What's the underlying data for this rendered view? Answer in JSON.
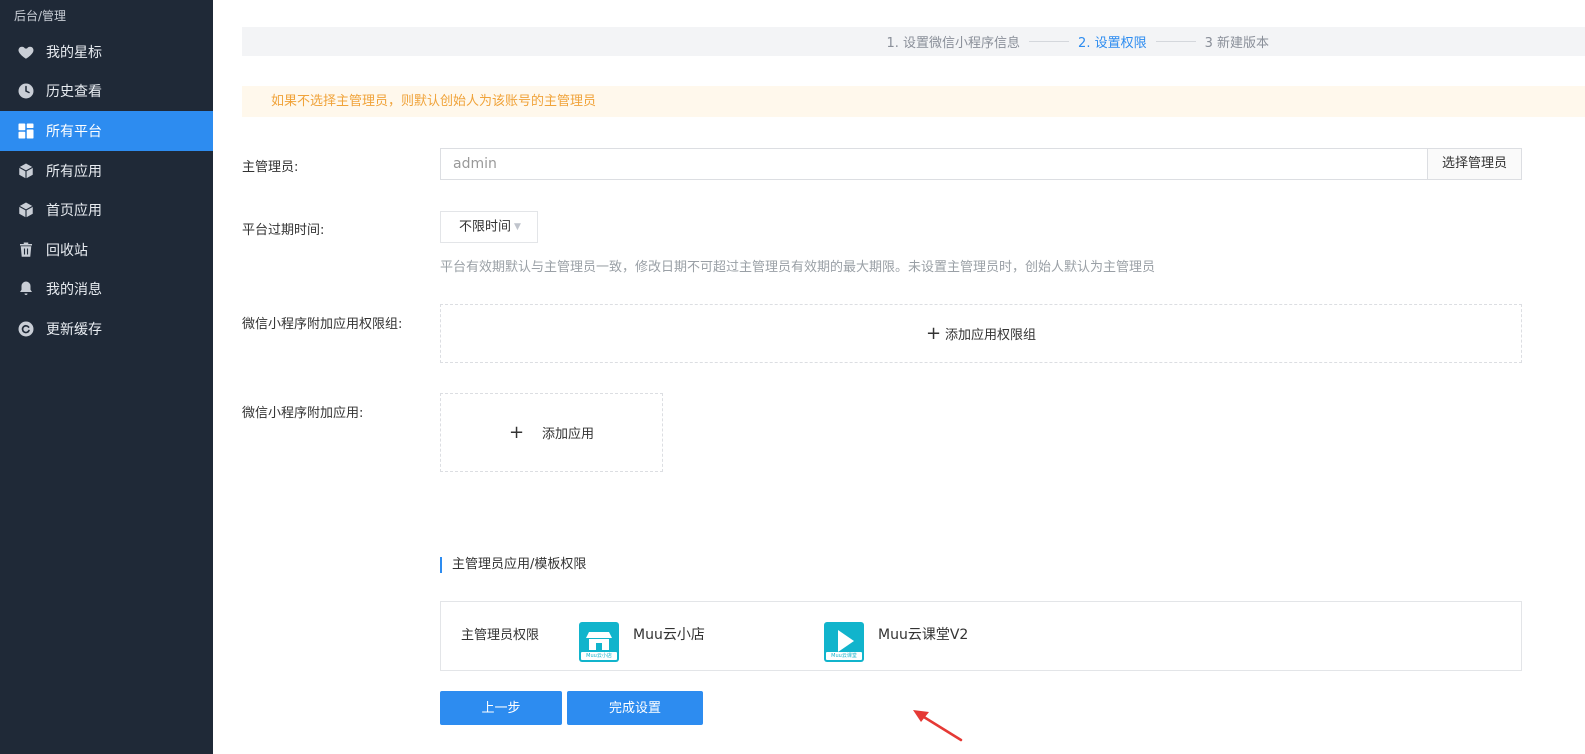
{
  "sidebar": {
    "breadcrumb": "后台/管理",
    "items": [
      {
        "label": "我的星标",
        "icon": "heart-icon"
      },
      {
        "label": "历史查看",
        "icon": "clock-icon"
      },
      {
        "label": "所有平台",
        "icon": "grid-icon"
      },
      {
        "label": "所有应用",
        "icon": "cube-icon"
      },
      {
        "label": "首页应用",
        "icon": "cube-icon"
      },
      {
        "label": "回收站",
        "icon": "trash-icon"
      },
      {
        "label": "我的消息",
        "icon": "bell-icon"
      },
      {
        "label": "更新缓存",
        "icon": "refresh-icon"
      }
    ],
    "active_index": 2
  },
  "steps": [
    {
      "label": "1. 设置微信小程序信息",
      "active": false
    },
    {
      "label": "2. 设置权限",
      "active": true
    },
    {
      "label": "3 新建版本",
      "active": false
    }
  ],
  "notice": "如果不选择主管理员，则默认创始人为该账号的主管理员",
  "form": {
    "admin_label": "主管理员:",
    "admin_placeholder": "admin",
    "select_admin_button": "选择管理员",
    "expiry_label": "平台过期时间:",
    "expiry_value": "不限时间",
    "expiry_hint": "平台有效期默认与主管理员一致，修改日期不可超过主管理员有效期的最大期限。未设置主管理员时，创始人默认为主管理员",
    "perm_group_label": "微信小程序附加应用权限组:",
    "add_perm_group": "添加应用权限组",
    "extra_app_label": "微信小程序附加应用:",
    "add_app": "添加应用"
  },
  "admin_perms": {
    "section_title": "主管理员应用/模板权限",
    "row_label": "主管理员权限",
    "apps": [
      {
        "name": "Muu云小店",
        "icon": "store-icon",
        "badge": "Muu云小店"
      },
      {
        "name": "Muu云课堂V2",
        "icon": "play-icon",
        "badge": "Muu云课堂"
      }
    ]
  },
  "buttons": {
    "prev": "上一步",
    "finish": "完成设置"
  },
  "colors": {
    "sidebar_bg": "#1f2937",
    "accent": "#2d8cf0",
    "notice_text": "#f0a33a",
    "app_icon": "#11b4cc",
    "arrow": "#e53935"
  }
}
